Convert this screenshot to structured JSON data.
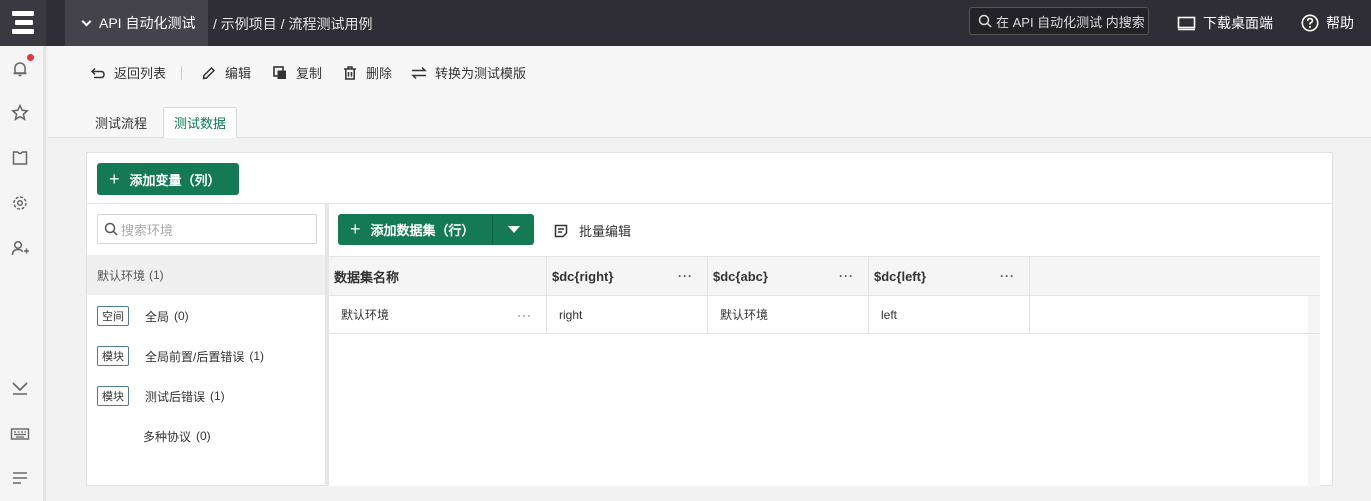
{
  "topbar": {
    "project": "API 自动化测试",
    "breadcrumb": "/ 示例项目 / 流程测试用例",
    "search_placeholder": "在 API 自动化测试 内搜索",
    "download": "下载桌面端",
    "help": "帮助"
  },
  "leftnav": {
    "icons": [
      "notification-icon",
      "star-icon",
      "shirt-icon",
      "settings-icon",
      "add-user-icon",
      "collapse-icon",
      "keyboard-icon",
      "menu-icon"
    ]
  },
  "toolbar": {
    "back": "返回列表",
    "edit": "编辑",
    "copy": "复制",
    "delete": "删除",
    "convert": "转换为测试模版"
  },
  "tabs": [
    "测试流程",
    "测试数据"
  ],
  "main": {
    "add_variable": "添加变量（列）",
    "env_search_placeholder": "搜索环境",
    "add_dataset": "添加数据集（行）",
    "batch_edit": "批量编辑"
  },
  "environments": [
    {
      "tag": "",
      "name": "默认环境",
      "count": "(1)"
    },
    {
      "tag": "空间",
      "name": "全局",
      "count": "(0)"
    },
    {
      "tag": "模块",
      "name": "全局前置/后置错误",
      "count": "(1)"
    },
    {
      "tag": "模块",
      "name": "测试后错误",
      "count": "(1)"
    },
    {
      "tag": "",
      "name": "多种协议",
      "count": "(0)"
    }
  ],
  "grid": {
    "columns": [
      "数据集名称",
      "$dc{right}",
      "$dc{abc}",
      "$dc{left}"
    ],
    "rows": [
      [
        "默认环境",
        "right",
        "默认环境",
        "left"
      ]
    ],
    "more": "···"
  },
  "colors": {
    "accent": "#137a54",
    "topbar": "#2f2e36",
    "alert": "#e5383b"
  }
}
